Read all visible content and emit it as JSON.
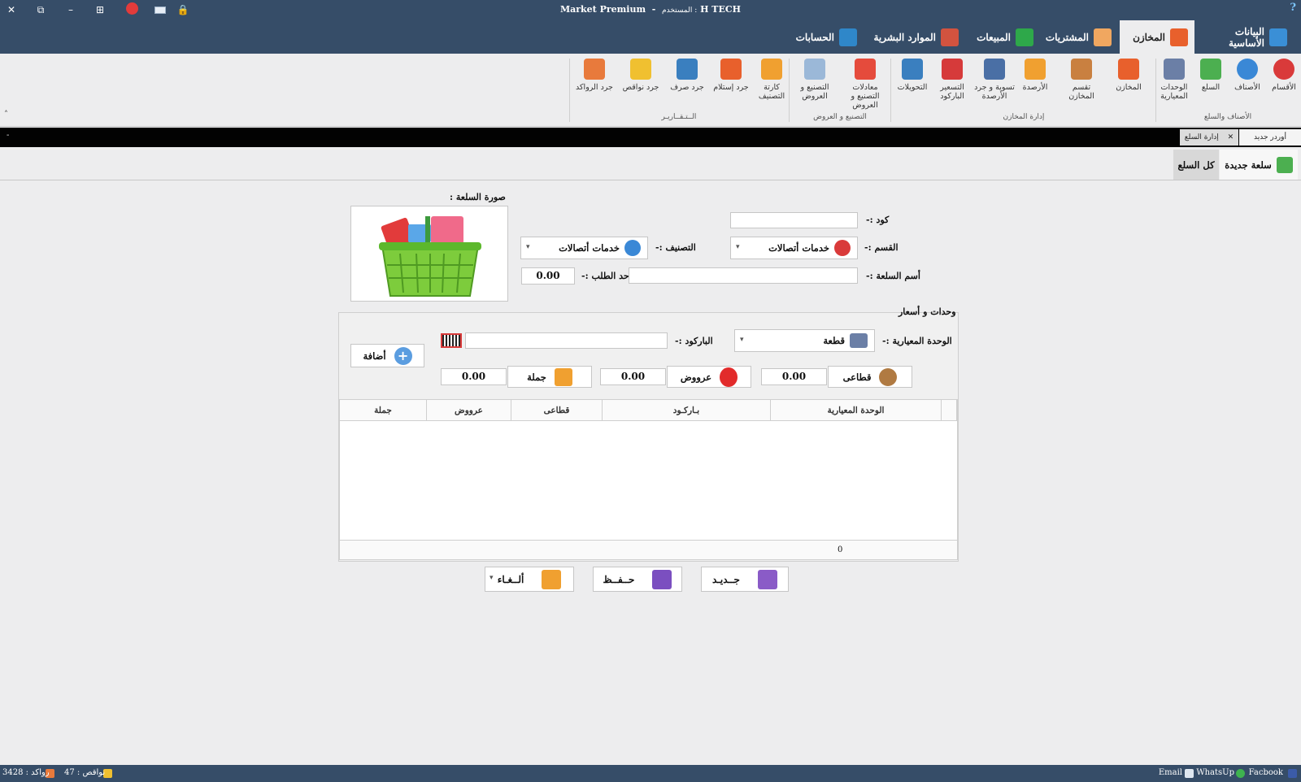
{
  "app": {
    "title": "Market Premium",
    "title_sep": "-",
    "user_label": "المستخدم :",
    "user_name": "H TECH",
    "help": "?"
  },
  "window_controls": {
    "close": "✕",
    "restore": "⧉",
    "minimize": "–",
    "keyboard": "⊞",
    "lock": "🔒"
  },
  "main_tabs": [
    {
      "label": "البيانات الأساسية",
      "icon": "building-icon",
      "color": "#3a8fd6"
    },
    {
      "label": "المخازن",
      "icon": "warehouse-icon",
      "color": "#e8602c"
    },
    {
      "label": "المشتريات",
      "icon": "purchases-icon",
      "color": "#f0a760"
    },
    {
      "label": "المبيعات",
      "icon": "sales-icon",
      "color": "#2ea84a"
    },
    {
      "label": "الموارد البشرية",
      "icon": "people-icon",
      "color": "#d2533f"
    },
    {
      "label": "الحسابات",
      "icon": "accounts-icon",
      "color": "#2f87c9"
    }
  ],
  "ribbon": {
    "groups": [
      {
        "label": "الأصناف والسلع"
      },
      {
        "label": "إدارة المخازن"
      },
      {
        "label": "التصنيع و العروض"
      },
      {
        "label": "الــتـقــاريـر"
      }
    ],
    "buttons": [
      {
        "label": "الأقسام",
        "icon": "sections-icon",
        "color": "#d93a3a"
      },
      {
        "label": "الأصناف",
        "icon": "share-icon",
        "color": "#3a88d6"
      },
      {
        "label": "السلع",
        "icon": "basket-icon",
        "color": "#4caf50"
      },
      {
        "label": "الوحدات المعيارية",
        "icon": "units-icon",
        "color": "#6b7fa6"
      },
      {
        "label": "المخازن",
        "icon": "warehouse-icon",
        "color": "#e8602c"
      },
      {
        "label": "تقسم المخازن",
        "icon": "warehouse-split-icon",
        "color": "#c98040"
      },
      {
        "label": "الأرصدة",
        "icon": "balances-icon",
        "color": "#f0a030"
      },
      {
        "label": "تسوية و جرد الأرصدة",
        "icon": "scale-icon",
        "color": "#4a6fa5"
      },
      {
        "label": "التسعير الباركود",
        "icon": "best-price-icon",
        "color": "#d63a3a"
      },
      {
        "label": "التحويلات",
        "icon": "transfer-icon",
        "color": "#3a7fbf"
      },
      {
        "label": "معادلات التصنيع و العروض",
        "icon": "formula-icon",
        "color": "#e54b3c"
      },
      {
        "label": "التصنيع و العروض",
        "icon": "manufacturing-icon",
        "color": "#9bb8d8"
      },
      {
        "label": "كارتة التصنيف",
        "icon": "card-icon",
        "color": "#f0a030"
      },
      {
        "label": "جرد إستلام",
        "icon": "receive-icon",
        "color": "#e8602c"
      },
      {
        "label": "جرد صرف",
        "icon": "issue-icon",
        "color": "#3a7fbf"
      },
      {
        "label": "جرد نواقص",
        "icon": "shortage-icon",
        "color": "#f0c030"
      },
      {
        "label": "جرد الرواكد",
        "icon": "stagnant-icon",
        "color": "#e87a3c"
      }
    ],
    "collapse": "˄"
  },
  "doc_tabs": [
    {
      "label": "أوردر جديد"
    },
    {
      "label": "إدارة السلع",
      "close": "✕"
    }
  ],
  "doc_strip_dash": "-",
  "sub_tabs": [
    {
      "label": "سلعة جديدة",
      "icon": "basket-icon"
    },
    {
      "label": "كل السلع"
    }
  ],
  "form": {
    "code_label": "كود :-",
    "code_value": "",
    "section_label": "القسم :-",
    "section_value": "خدمات أتصالات",
    "category_label": "التصنيف :-",
    "category_value": "خدمات أتصالات",
    "name_label": "أسم السلعة :-",
    "name_value": "",
    "reorder_label": "حد الطلب :-",
    "reorder_value": "0.00",
    "photo_label": "صورة السلعة :",
    "dropdown_arrow": "▾"
  },
  "units": {
    "section_title": "وحدات و أسعار",
    "unit_label": "الوحدة المعيارية :-",
    "unit_value": "قطعة",
    "barcode_label": "الباركود :-",
    "barcode_value": "",
    "add_button": "أضافة",
    "retail_label": "قطاعى",
    "retail_value": "0.00",
    "offers_label": "عرووض",
    "offers_value": "0.00",
    "wholesale_label": "جملة",
    "wholesale_value": "0.00"
  },
  "grid": {
    "columns": [
      "الوحدة المعيارية",
      "بـاركـود",
      "قطاعى",
      "عرووض",
      "جملة"
    ],
    "rows": [],
    "footer_count": "0"
  },
  "actions": {
    "new": "جــديـد",
    "save": "حــفــظ",
    "cancel": "ألــغـاء"
  },
  "status": {
    "facebook": "Facbook",
    "whatsapp": "WhatsUp",
    "email": "Email",
    "shortages": "نواقص : 47",
    "stagnant": "رواكد : 3428"
  }
}
